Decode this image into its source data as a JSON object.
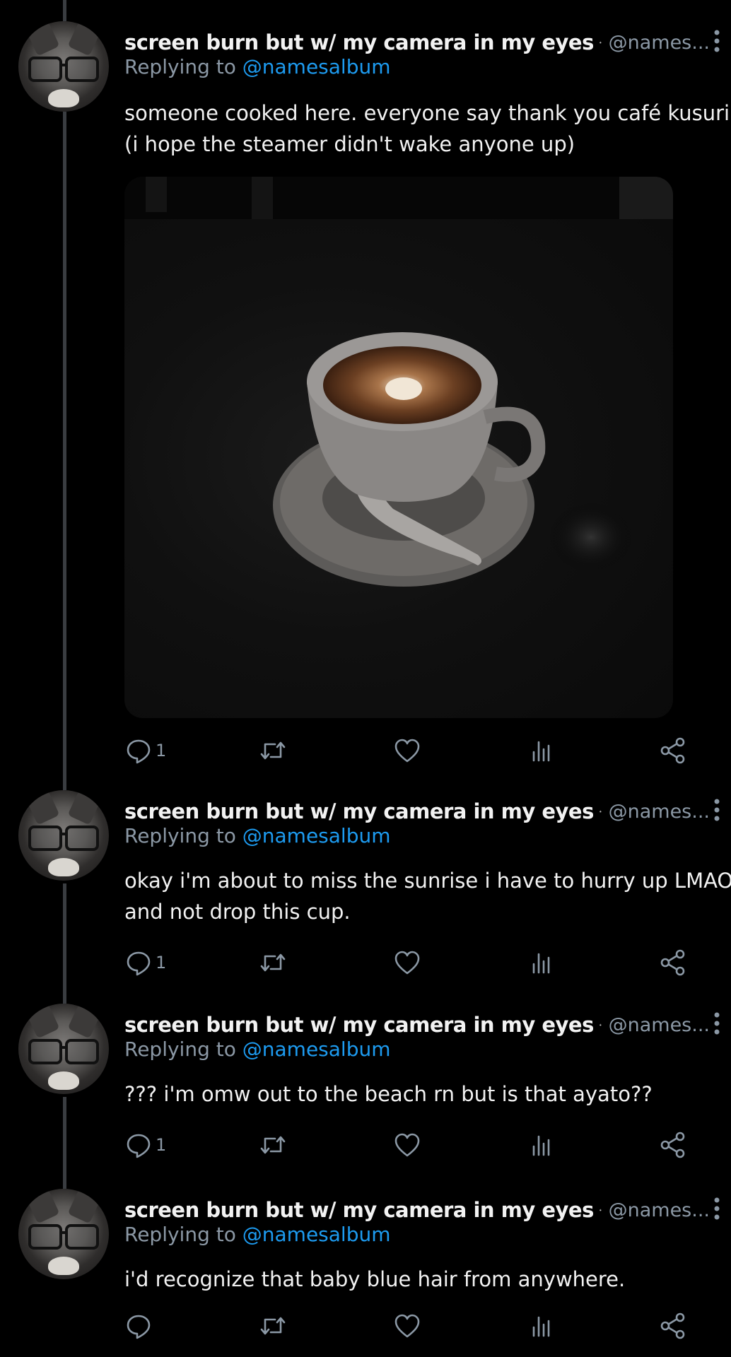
{
  "author": {
    "name": "screen burn but w/ my camera in my eyes",
    "handle": "@names...",
    "reply_prefix": "Replying to",
    "reply_to": "@namesalbum"
  },
  "tweets": [
    {
      "lines": [
        "someone cooked here. everyone say thank you café kusuri",
        "(i hope the steamer didn't wake anyone up)"
      ],
      "reply_count": "1"
    },
    {
      "lines": [
        "okay i'm about to miss the sunrise i have to hurry up LMAO",
        "and not drop this cup."
      ],
      "reply_count": "1"
    },
    {
      "lines": [
        "??? i'm omw out to the beach rn but is that ayato??"
      ],
      "reply_count": "1"
    },
    {
      "lines": [
        "i'd recognize that baby blue hair from anywhere."
      ],
      "reply_count": ""
    }
  ],
  "colors": {
    "background": "#000000",
    "text": "#e7e9ea",
    "secondary": "#8b98a5",
    "accent": "#1d9bf0"
  },
  "icons": [
    "lock-icon",
    "more-options-icon",
    "reply-icon",
    "retweet-icon",
    "like-icon",
    "views-icon",
    "share-icon"
  ]
}
